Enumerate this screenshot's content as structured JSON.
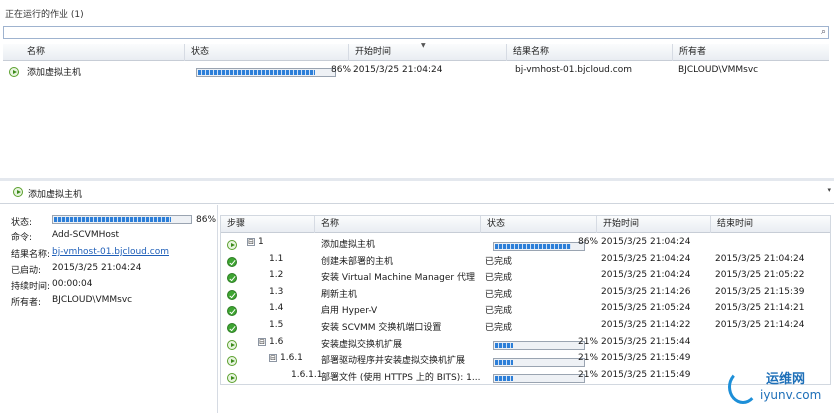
{
  "top": {
    "title": "正在运行的作业 (1)",
    "columns": [
      "名称",
      "状态",
      "开始时间",
      "结果名称",
      "所有者"
    ],
    "job": {
      "name": "添加虚拟主机",
      "progress": 0.86,
      "percent": "86%",
      "start": "2015/3/25 21:04:24",
      "result": "bj-vmhost-01.bjcloud.com",
      "owner": "BJCLOUD\\VMMsvc"
    }
  },
  "detail": {
    "title": "添加虚拟主机",
    "labels": {
      "status": "状态:",
      "command": "命令:",
      "result": "结果名称:",
      "started": "已启动:",
      "duration": "持续时间:",
      "owner": "所有者:"
    },
    "values": {
      "progress": 0.86,
      "percent": "86%",
      "command": "Add-SCVMHost",
      "result": "bj-vmhost-01.bjcloud.com",
      "started": "2015/3/25 21:04:24",
      "duration": "00:00:04",
      "owner": "BJCLOUD\\VMMsvc"
    }
  },
  "steps": {
    "columns": [
      "步骤",
      "名称",
      "状态",
      "开始时间",
      "结束时间"
    ],
    "rows": [
      {
        "icon": "run",
        "toggle": "⊟",
        "step": "1",
        "name": "添加虚拟主机",
        "status": "",
        "progress": 0.86,
        "percent": "86%",
        "start": "2015/3/25 21:04:24",
        "end": ""
      },
      {
        "icon": "ok",
        "toggle": "",
        "step": "1.1",
        "name": "创建未部署的主机",
        "status": "已完成",
        "progress": null,
        "percent": "",
        "start": "2015/3/25 21:04:24",
        "end": "2015/3/25 21:04:24"
      },
      {
        "icon": "ok",
        "toggle": "",
        "step": "1.2",
        "name": "安装 Virtual Machine Manager 代理",
        "status": "已完成",
        "progress": null,
        "percent": "",
        "start": "2015/3/25 21:04:24",
        "end": "2015/3/25 21:05:22"
      },
      {
        "icon": "ok",
        "toggle": "",
        "step": "1.3",
        "name": "刷新主机",
        "status": "已完成",
        "progress": null,
        "percent": "",
        "start": "2015/3/25 21:14:26",
        "end": "2015/3/25 21:15:39"
      },
      {
        "icon": "ok",
        "toggle": "",
        "step": "1.4",
        "name": "启用 Hyper-V",
        "status": "已完成",
        "progress": null,
        "percent": "",
        "start": "2015/3/25 21:05:24",
        "end": "2015/3/25 21:14:21"
      },
      {
        "icon": "ok",
        "toggle": "",
        "step": "1.5",
        "name": "安装 SCVMM 交换机端口设置",
        "status": "已完成",
        "progress": null,
        "percent": "",
        "start": "2015/3/25 21:14:22",
        "end": "2015/3/25 21:14:24"
      },
      {
        "icon": "run",
        "toggle": "⊟",
        "step": "1.6",
        "name": "安装虚拟交换机扩展",
        "status": "",
        "progress": 0.21,
        "percent": "21%",
        "start": "2015/3/25 21:15:44",
        "end": ""
      },
      {
        "icon": "run",
        "toggle": "⊟",
        "step": "1.6.1",
        "name": "部署驱动程序并安装虚拟交换机扩展",
        "status": "",
        "progress": 0.21,
        "percent": "21%",
        "start": "2015/3/25 21:15:49",
        "end": ""
      },
      {
        "icon": "run",
        "toggle": "",
        "step": "1.6.1.1",
        "name": "部署文件 (使用 HTTPS 上的 BITS): 1...",
        "status": "",
        "progress": 0.21,
        "percent": "21%",
        "start": "2015/3/25 21:15:49",
        "end": ""
      }
    ]
  },
  "watermark": {
    "brand": "运维网",
    "domain": "iyunv.com"
  }
}
